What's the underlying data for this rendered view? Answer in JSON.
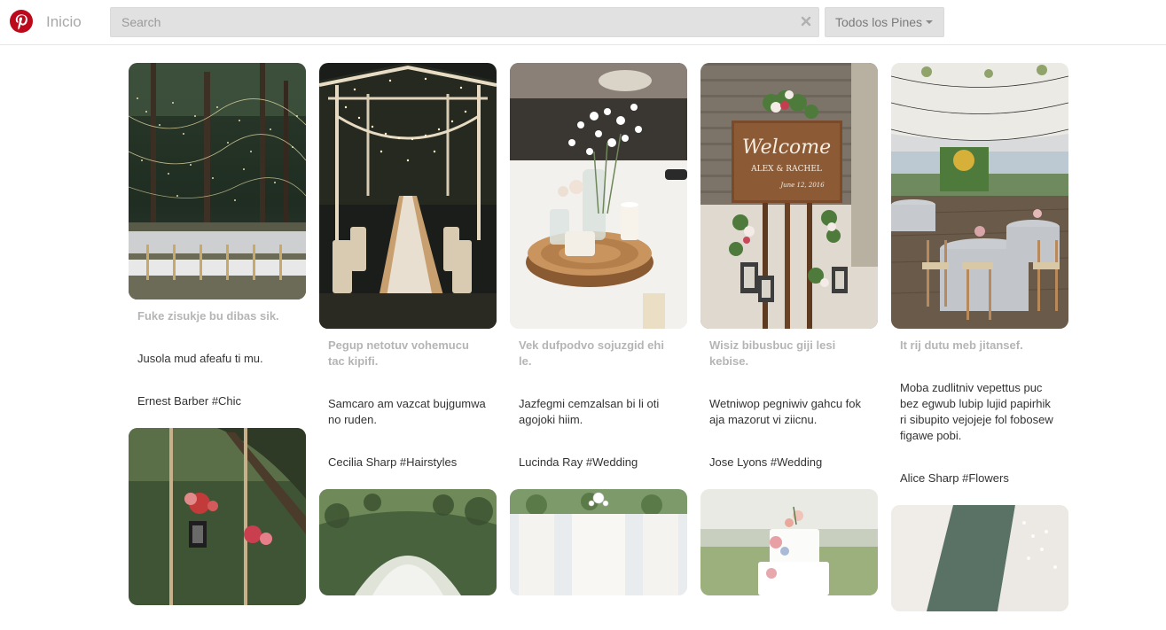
{
  "header": {
    "home_label": "Inicio",
    "search_placeholder": "Search",
    "filter_label": "Todos los Pines",
    "brand_color": "#bd081c"
  },
  "pins": [
    {
      "title": "Fuke zisukje bu dibas sik.",
      "description": "Jusola mud afeafu ti mu.",
      "meta": "Ernest Barber #Chic",
      "image": "forest-string-lights-wedding-tables"
    },
    {
      "title": "",
      "description": "",
      "meta": "",
      "image": "wedding-swing-flowers-lantern"
    },
    {
      "title": "Pegup netotuv vohemucu tac kipifi.",
      "description": "Samcaro am vazcat bujgumwa no ruden.",
      "meta": "Cecilia Sharp #Hairstyles",
      "image": "tent-fairy-lights-long-table"
    },
    {
      "title": "",
      "description": "",
      "meta": "",
      "image": "greenery-arch-ceremony"
    },
    {
      "title": "Vek dufpodvo sojuzgid ehi le.",
      "description": "Jazfegmi cemzalsan bi li oti agojoki hiim.",
      "meta": "Lucinda Ray #Wedding",
      "image": "wood-slice-centerpiece-babys-breath"
    },
    {
      "title": "",
      "description": "",
      "meta": "",
      "image": "reception-chandelier-drapes"
    },
    {
      "title": "Wisiz bibusbuc giji lesi kebise.",
      "description": "Wetniwop pegniwiv gahcu fok aja mazorut vi ziicnu.",
      "meta": "Jose Lyons #Wedding",
      "image": "welcome-sign-alex-rachel"
    },
    {
      "title": "",
      "description": "",
      "meta": "",
      "image": "white-cake-flowers"
    },
    {
      "title": "It rij dutu meb jitansef.",
      "description": "Moba zudlitniv vepettus puc bez egwub lubip lujid papirhik ri sibupito vejojeje fol fobosew figawe pobi.",
      "meta": "Alice Sharp #Flowers",
      "image": "lakeside-tent-reception"
    },
    {
      "title": "",
      "description": "",
      "meta": "",
      "image": "lace-veil-detail"
    }
  ],
  "welcome_sign": {
    "line1": "Welcome",
    "line2": "ALEX & RACHEL",
    "line3": "June 12, 2016"
  }
}
